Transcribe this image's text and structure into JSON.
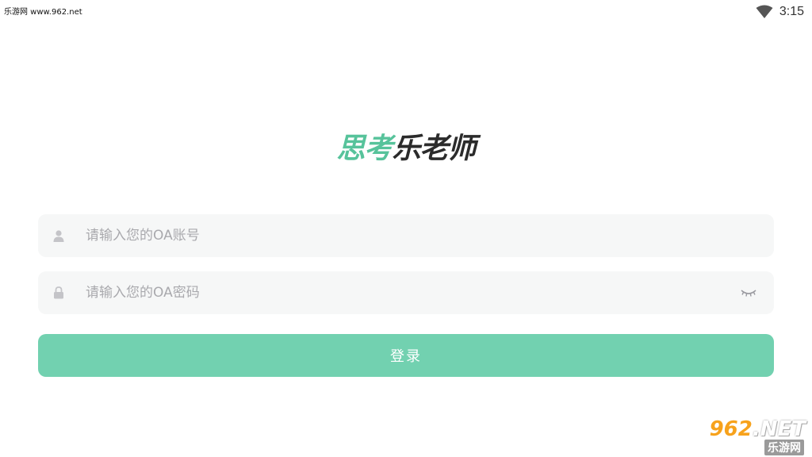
{
  "status_bar": {
    "source_tag": "乐游网 www.962.net",
    "time": "3:15",
    "icons": [
      "wifi-icon"
    ]
  },
  "logo": {
    "part1": "思考",
    "part2": "乐老师"
  },
  "form": {
    "account_placeholder": "请输入您的OA账号",
    "account_value": "",
    "password_placeholder": "请输入您的OA密码",
    "password_value": "",
    "account_icon": "user-icon",
    "password_icon": "lock-icon",
    "toggle_icon": "eye-closed-icon"
  },
  "login_button": {
    "label": "登录"
  },
  "watermark": {
    "brand_number": "962",
    "brand_suffix": ".NET",
    "brand_sub": "乐游网"
  },
  "colors": {
    "accent": "#72d1b0",
    "logo_green": "#57c39b",
    "logo_dark": "#2b2b2b",
    "field_bg": "#f6f7f7",
    "placeholder": "#a9a9ad"
  }
}
